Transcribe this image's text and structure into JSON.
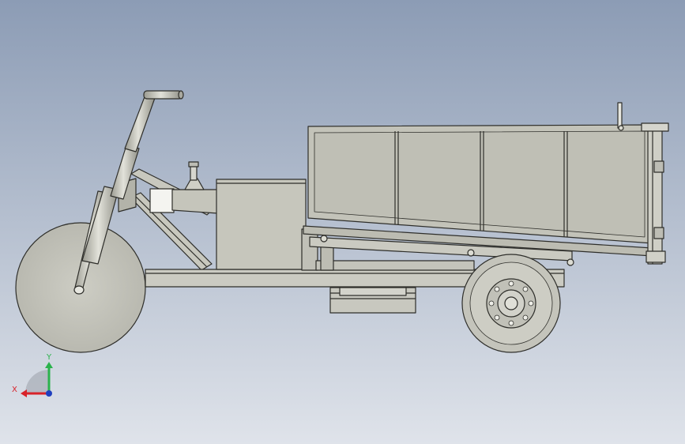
{
  "viewport": {
    "background_top": "#8c9cb5",
    "background_bottom": "#dfe3ea",
    "model_fill": "#c3c3b9",
    "model_fill_light": "#d1d1c8",
    "model_fill_dark": "#a9a99f",
    "edge_color": "#2e2e2a"
  },
  "triad": {
    "x_label": "X",
    "y_label": "Y",
    "x_color": "#d8232a",
    "y_color": "#2bb24c",
    "z_color": "#1f3fbf"
  }
}
